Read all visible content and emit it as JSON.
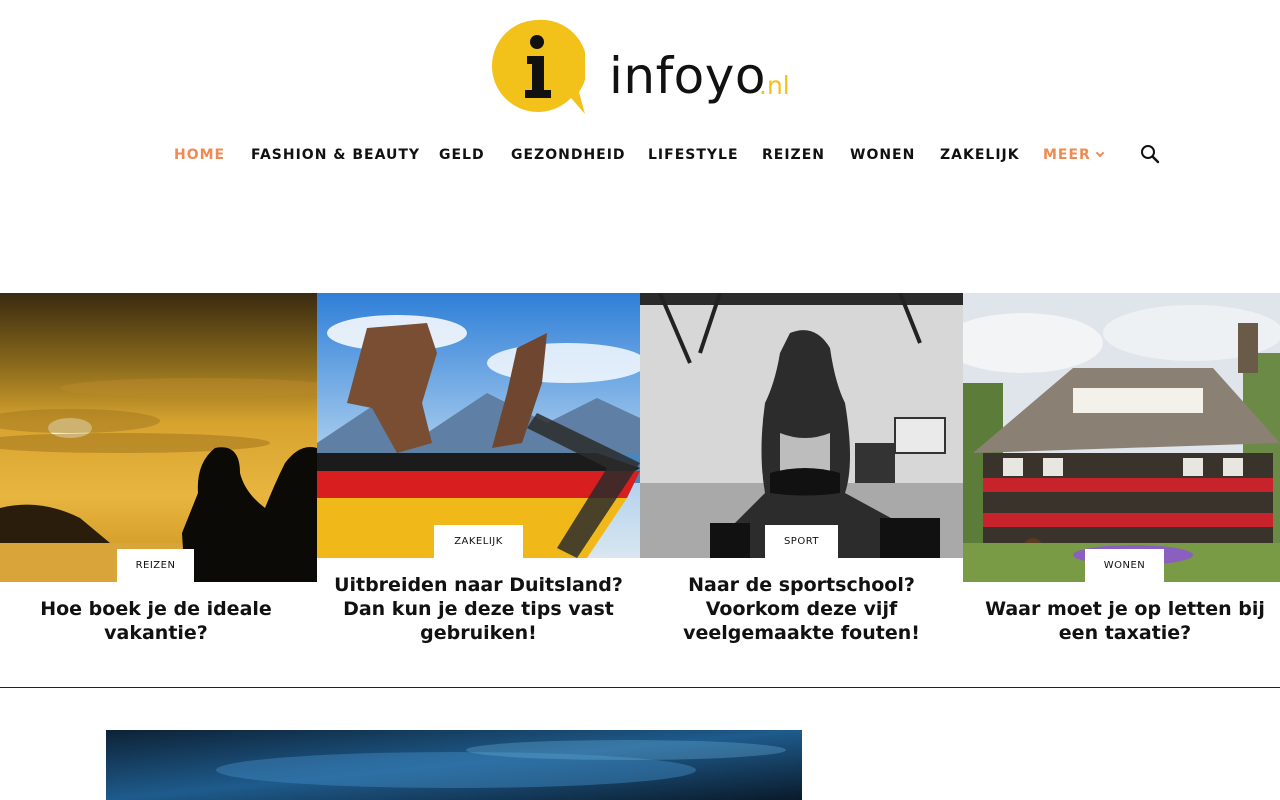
{
  "site": {
    "name": "infoyo",
    "tld": ".nl",
    "logo_letter": "i",
    "accent_color": "#ef8a52",
    "logo_color": "#f2c21b"
  },
  "nav": {
    "items": [
      {
        "label": "HOME",
        "active": true
      },
      {
        "label": "FASHION & BEAUTY"
      },
      {
        "label": "GELD"
      },
      {
        "label": "GEZONDHEID"
      },
      {
        "label": "LIFESTYLE"
      },
      {
        "label": "REIZEN"
      },
      {
        "label": "WONEN"
      },
      {
        "label": "ZAKELIJK"
      },
      {
        "label": "MEER",
        "has_dropdown": true
      }
    ],
    "search_icon": "search-icon"
  },
  "articles": [
    {
      "category": "REIZEN",
      "title": "Hoe boek je de ideale vakantie?"
    },
    {
      "category": "ZAKELIJK",
      "title": "Uitbreiden naar Duitsland? Dan kun je deze tips vast gebruiken!"
    },
    {
      "category": "SPORT",
      "title": "Naar de sportschool? Voorkom deze vijf veelgemaakte fouten!"
    },
    {
      "category": "WONEN",
      "title": "Waar moet je op letten bij een taxatie?"
    }
  ]
}
